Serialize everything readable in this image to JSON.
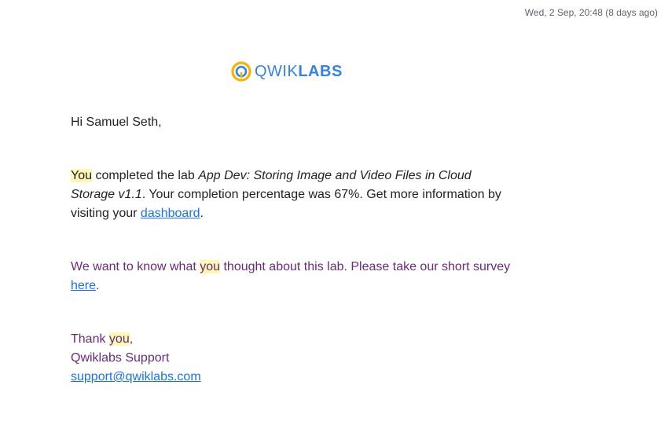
{
  "header": {
    "timestamp": "Wed, 2 Sep, 20:48 (8 days ago)"
  },
  "logo": {
    "brand_light": "QWIK",
    "brand_bold": "LABS",
    "colors": {
      "outer_ring": "#f4b400",
      "inner_mark": "#3681e3",
      "text": "#3681e3"
    }
  },
  "email": {
    "greeting": "Hi Samuel Seth,",
    "completion": {
      "you_highlight": "You",
      "text_before_lab": " completed the lab ",
      "lab_name": "App Dev: Storing Image and Video Files in Cloud Storage v1.1",
      "text_after_lab": ". Your completion percentage was 67%. Get more information by visiting your ",
      "dashboard_link": "dashboard",
      "end": "."
    },
    "survey": {
      "text_before_you": "We want to know what ",
      "you_highlight": "you",
      "text_after_you": " thought about this lab. Please take our short survey ",
      "here_link": "here",
      "end": "."
    },
    "signoff": {
      "thank": "Thank ",
      "you_highlight": "you",
      "comma": ",",
      "team": "Qwiklabs Support",
      "email_link": "support@qwiklabs.com"
    }
  },
  "colors": {
    "highlight": "#fff7b3",
    "link": "#1a73e8",
    "purple_text": "#6b2a7a",
    "body_text": "#222222",
    "timestamp": "#5f6368"
  }
}
